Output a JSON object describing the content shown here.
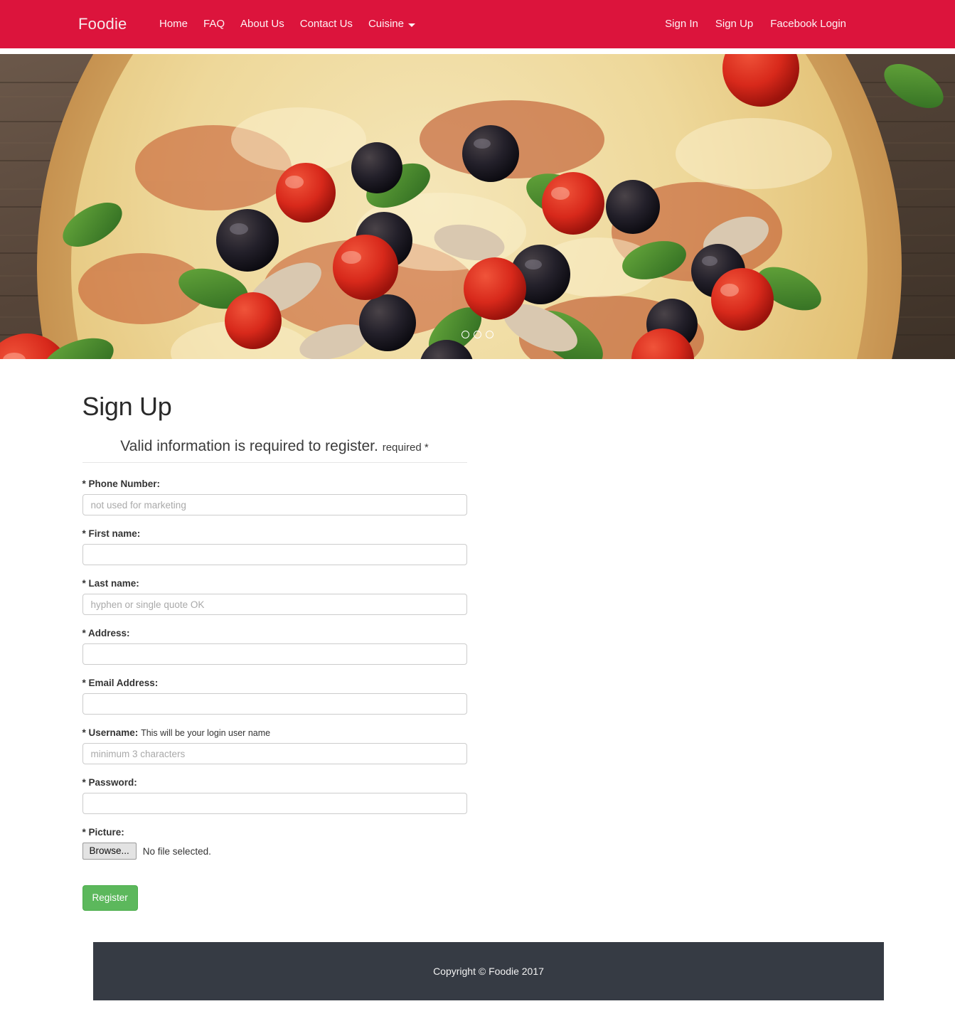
{
  "navbar": {
    "brand": "Foodie",
    "left_links": [
      {
        "label": "Home",
        "name": "nav-link-home"
      },
      {
        "label": "FAQ",
        "name": "nav-link-faq"
      },
      {
        "label": "About Us",
        "name": "nav-link-about-us"
      },
      {
        "label": "Contact Us",
        "name": "nav-link-contact-us"
      },
      {
        "label": "Cuisine",
        "name": "nav-dropdown-cuisine",
        "has_caret": true
      }
    ],
    "right_links": [
      {
        "label": "Sign In",
        "name": "nav-link-sign-in"
      },
      {
        "label": "Sign Up",
        "name": "nav-link-sign-up"
      },
      {
        "label": "Facebook Login",
        "name": "nav-link-facebook-login"
      }
    ],
    "background_color": "#dc143c",
    "link_color": "#fdf3f5"
  },
  "hero": {
    "alt": "Close-up photo of a pizza with black olives, cherry tomatoes, basil and mushrooms on a wooden board",
    "indicator_count": 3,
    "active_indicator": 0
  },
  "page": {
    "title": "Sign Up"
  },
  "form": {
    "legend_main": "Valid information is required to register.",
    "legend_note": "required *",
    "fields": [
      {
        "label": "* Phone Number:",
        "placeholder": "not used for marketing",
        "value": "",
        "type": "text",
        "name": "phone-number"
      },
      {
        "label": "* First name:",
        "placeholder": "",
        "value": "",
        "type": "text",
        "name": "first-name"
      },
      {
        "label": "* Last name:",
        "placeholder": "hyphen or single quote OK",
        "value": "",
        "type": "text",
        "name": "last-name"
      },
      {
        "label": "* Address:",
        "placeholder": "",
        "value": "",
        "type": "text",
        "name": "address"
      },
      {
        "label": "* Email Address:",
        "placeholder": "",
        "value": "",
        "type": "text",
        "name": "email-address"
      },
      {
        "label": "* Username:",
        "help": "This will be your login user name",
        "placeholder": "minimum 3 characters",
        "value": "",
        "type": "text",
        "name": "username"
      },
      {
        "label": "* Password:",
        "placeholder": "",
        "value": "",
        "type": "password",
        "name": "password"
      }
    ],
    "picture": {
      "label": "* Picture:",
      "browse_label": "Browse...",
      "file_status": "No file selected."
    },
    "submit_label": "Register",
    "submit_color": "#5cb85c"
  },
  "footer": {
    "text": "Copyright © Foodie 2017",
    "background_color": "#363b44"
  }
}
